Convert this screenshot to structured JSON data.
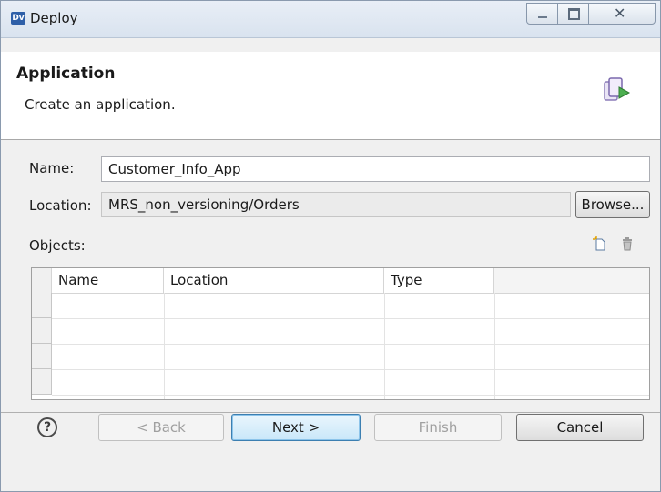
{
  "window": {
    "title": "Deploy",
    "app_icon_text": "Dv"
  },
  "header": {
    "title": "Application",
    "description": "Create an application."
  },
  "form": {
    "name_label": "Name:",
    "name_value": "Customer_Info_App",
    "location_label": "Location:",
    "location_value": "MRS_non_versioning/Orders",
    "browse_label": "Browse...",
    "objects_label": "Objects:"
  },
  "table": {
    "columns": [
      "Name",
      "Location",
      "Type",
      ""
    ],
    "rows": []
  },
  "footer": {
    "help": "?",
    "back_label": "< Back",
    "next_label": "Next >",
    "finish_label": "Finish",
    "cancel_label": "Cancel"
  },
  "icons": {
    "app": "dv-app-icon",
    "wizard": "deploy-wizard-icon",
    "new_object": "new-object-icon",
    "delete": "delete-trash-icon"
  }
}
